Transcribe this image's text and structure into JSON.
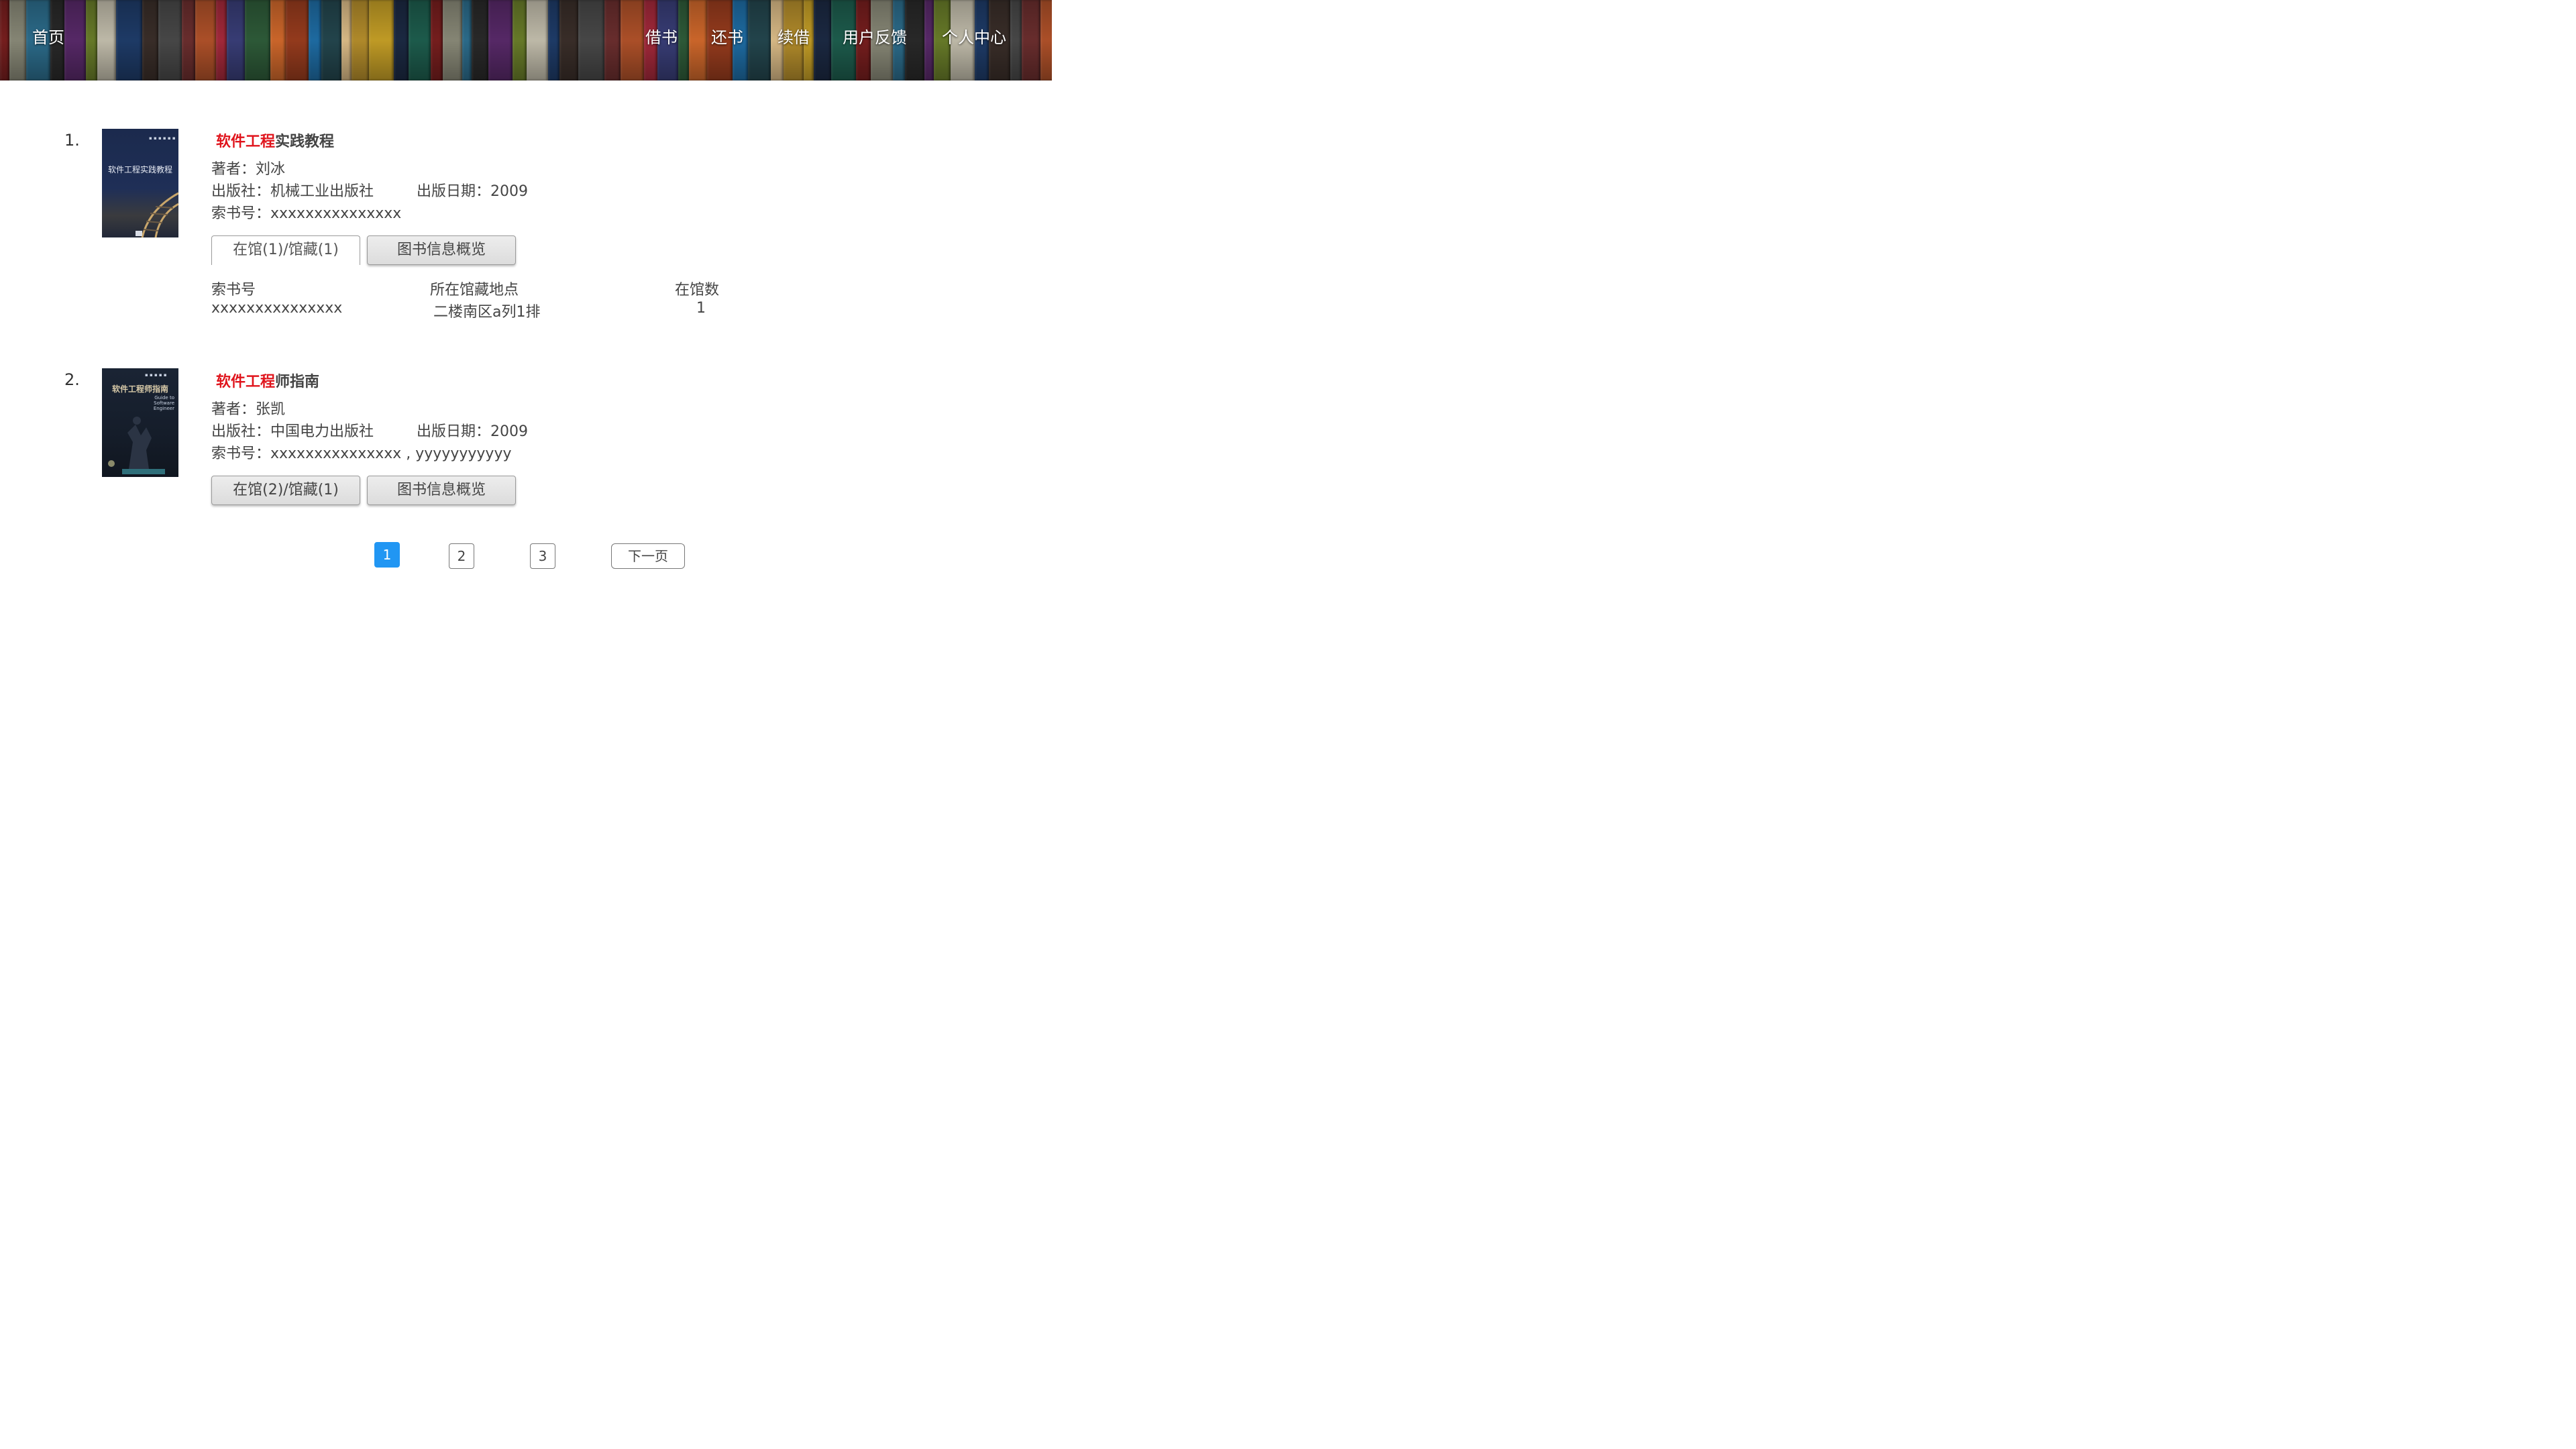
{
  "nav": {
    "home": "首页",
    "borrow": "借书",
    "return": "还书",
    "renew": "续借",
    "feedback": "用户反馈",
    "profile": "个人中心"
  },
  "results": [
    {
      "index": "1.",
      "title_highlight": "软件工程",
      "title_rest": "实践教程",
      "cover_title": "软件工程实践教程",
      "author": "著者：刘冰",
      "publisher": "出版社：机械工业出版社",
      "pub_date": "出版日期：2009",
      "call_number": "索书号：xxxxxxxxxxxxxxx",
      "availability_button": "在馆(1)/馆藏(1)",
      "overview_button": "图书信息概览",
      "holdings": {
        "headers": [
          "索书号",
          "所在馆藏地点",
          "在馆数"
        ],
        "rows": [
          [
            "xxxxxxxxxxxxxxx",
            "二楼南区a列1排",
            "1"
          ]
        ]
      }
    },
    {
      "index": "2.",
      "title_highlight": "软件工程",
      "title_rest": "师指南",
      "cover_title": "软件工程师指南",
      "cover_subtitle": "Guide to Software Engineer",
      "author": "著者：张凯",
      "publisher": "出版社：中国电力出版社",
      "pub_date": "出版日期：2009",
      "call_number": "索书号：xxxxxxxxxxxxxxx , yyyyyyyyyyy",
      "availability_button": "在馆(2)/馆藏(1)",
      "overview_button": "图书信息概览"
    }
  ],
  "pagination": {
    "pages": [
      "1",
      "2",
      "3"
    ],
    "current": "1",
    "next_label": "下一页"
  },
  "colors": {
    "keyword_highlight": "#e0141c",
    "active_page": "#2196f3"
  }
}
